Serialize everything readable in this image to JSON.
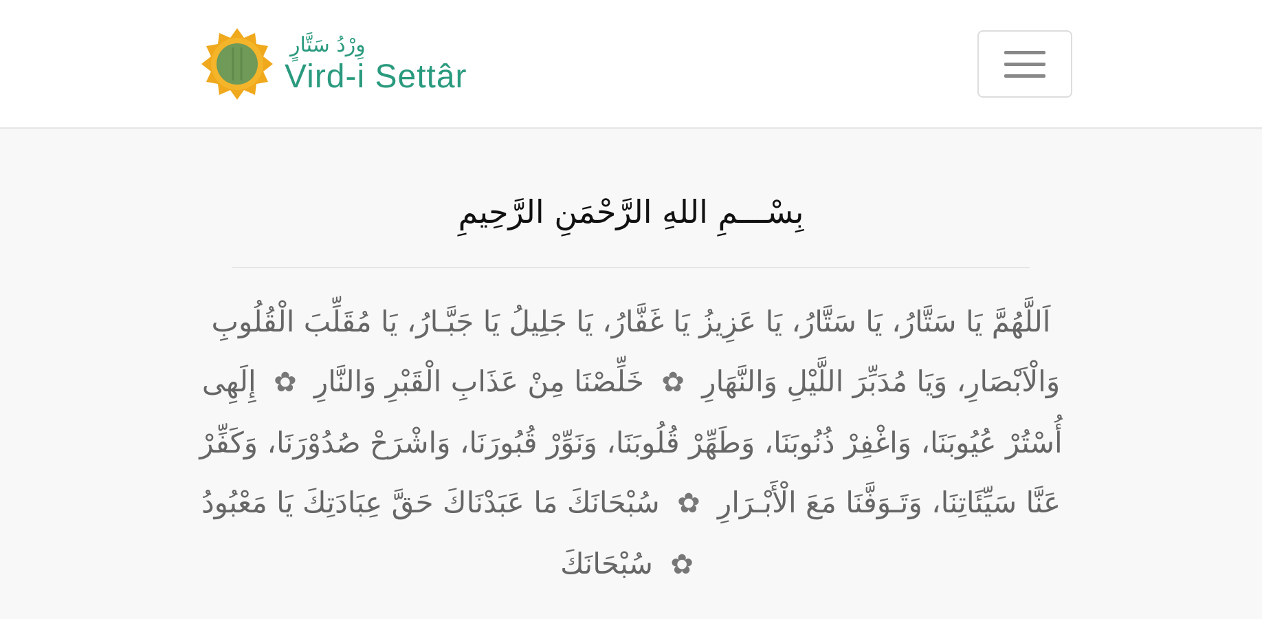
{
  "brand": {
    "arabic": "وِرْدُ سَتَّارٍ",
    "latin": "Vird-i Settâr"
  },
  "menu": {
    "toggle_icon": "hamburger-icon"
  },
  "page": {
    "basmala": "بِسْـــمِ اللهِ الرَّحْمَنِ الرَّحِيمِ",
    "separator_glyph": "✿",
    "prayer_segments": [
      "اَللَّهُمَّ يَا سَتَّارُ، يَا سَتَّارُ، يَا عَزِيزُ يَا غَفَّارُ، يَا جَلِيلُ يَا جَبَّـارُ، يَا مُقَلِّبَ الْقُلُوبِ وَالْاَبْصَارِ، وَيَا مُدَبِّرَ اللَّيْلِ وَالنَّهَارِ",
      "خَلِّصْنَا مِنْ عَذَابِ الْقَبْرِ وَالنَّارِ",
      "إِلَهِى أُسْتُرْ عُيُوبَنَا، وَاغْفِرْ ذُنُوبَنَا، وَطَهِّرْ قُلُوبَنَا، وَنَوِّرْ قُبُورَنَا، وَاشْرَحْ صُدُوْرَنَا، وَكَفِّرْ عَنَّا سَيِّئَاتِنَا، وَتَـوَفَّنَا مَعَ الْأَبْـرَارِ",
      "سُبْحَانَكَ مَا عَبَدْنَاكَ حَقَّ عِبَادَتِكَ يَا مَعْبُودُ",
      "سُبْحَانَكَ"
    ]
  },
  "colors": {
    "brand_green": "#2a9a7e",
    "logo_gold": "#f0a81c",
    "logo_center": "#6f9a58",
    "text_gray": "#666666"
  }
}
